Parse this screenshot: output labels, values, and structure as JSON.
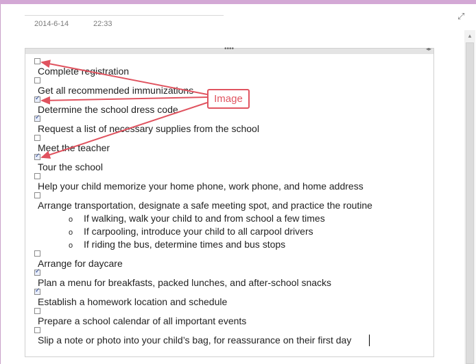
{
  "meta": {
    "date": "2014-6-14",
    "time": "22:33"
  },
  "checklist": [
    {
      "label": "Complete registration",
      "checked": false
    },
    {
      "label": "Get all recommended immunizations",
      "checked": false
    },
    {
      "label": "Determine the school dress code",
      "checked": true
    },
    {
      "label": "Request a list of necessary supplies from the school",
      "checked": true
    },
    {
      "label": "Meet the teacher",
      "checked": false
    },
    {
      "label": "Tour the school",
      "checked": true
    },
    {
      "label": "Help your child memorize your home phone, work phone, and home address",
      "checked": false
    },
    {
      "label": "Arrange transportation, designate a safe meeting spot, and practice the routine",
      "checked": false
    },
    {
      "label": "Arrange for daycare",
      "checked": false
    },
    {
      "label": "Plan a menu for breakfasts, packed lunches, and after-school snacks",
      "checked": true
    },
    {
      "label": "Establish a homework location and schedule",
      "checked": true
    },
    {
      "label": "Prepare a school calendar of all important events",
      "checked": false
    },
    {
      "label": "Slip a note or photo into your child’s bag, for reassurance on their first day",
      "checked": false
    }
  ],
  "sub_bullets": [
    "If walking, walk your child to and from school a few times",
    "If carpooling, introduce your child to all carpool drivers",
    "If riding the bus, determine times and bus stops"
  ],
  "bullet_glyph": "o",
  "callout": {
    "label": "Image"
  },
  "icons": {
    "expand": "expand-icon",
    "grip": "drag-grip-icon",
    "resize": "resize-icon"
  },
  "colors": {
    "callout": "#e0535f",
    "top_band": "#d3a8d5"
  }
}
